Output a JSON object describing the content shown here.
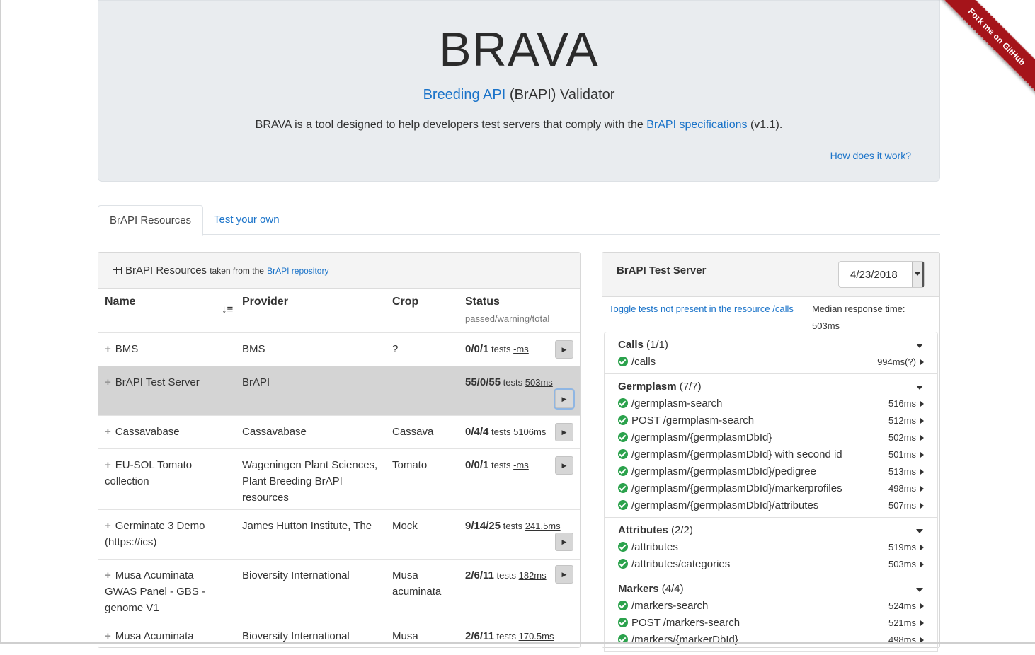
{
  "header": {
    "title": "BRAVA",
    "subtitle_link": "Breeding API",
    "subtitle_rest": " (BrAPI) Validator",
    "desc_pre": "BRAVA is a tool designed to help developers test servers that comply with the ",
    "desc_link": "BrAPI specifications",
    "desc_post": " (v1.1).",
    "how_link": "How does it work?",
    "ribbon": "Fork me on GitHub"
  },
  "tabs": [
    "BrAPI Resources",
    "Test your own"
  ],
  "resources": {
    "heading": "BrAPI Resources",
    "taken_from": "taken from the",
    "repo_link": "BrAPI repository",
    "columns": {
      "name": "Name",
      "provider": "Provider",
      "crop": "Crop",
      "status": "Status",
      "status_sub": "passed/warning/total"
    },
    "tests_word": "tests",
    "rows": [
      {
        "name": "BMS",
        "provider": "BMS",
        "crop": "?",
        "status": "0/0/1",
        "ms": "-ms"
      },
      {
        "name": "BrAPI Test Server",
        "provider": "BrAPI",
        "crop": "",
        "status": "55/0/55",
        "ms": "503ms"
      },
      {
        "name": "Cassavabase",
        "provider": "Cassavabase",
        "crop": "Cassava",
        "status": "0/4/4",
        "ms": "5106ms"
      },
      {
        "name": "EU-SOL Tomato collection",
        "provider": "Wageningen Plant Sciences, Plant Breeding BrAPI resources",
        "crop": "Tomato",
        "status": "0/0/1",
        "ms": "-ms"
      },
      {
        "name": "Germinate 3 Demo (https://ics)",
        "provider": "James Hutton Institute, The",
        "crop": "Mock",
        "status": "9/14/25",
        "ms": "241.5ms"
      },
      {
        "name": "Musa Acuminata GWAS Panel - GBS - genome V1",
        "provider": "Bioversity International",
        "crop": "Musa acuminata",
        "status": "2/6/11",
        "ms": "182ms"
      },
      {
        "name": "Musa Acuminata",
        "provider": "Bioversity International",
        "crop": "Musa",
        "status": "2/6/11",
        "ms": "170.5ms"
      }
    ]
  },
  "server": {
    "title": "BrAPI Test Server",
    "date": "4/23/2018",
    "toggle": "Toggle tests not present in the resource /calls",
    "median_label": "Median response time:",
    "median_value": "503ms",
    "groups": [
      {
        "name": "Calls",
        "count": "(1/1)",
        "calls": [
          {
            "path": "/calls",
            "time": "994ms",
            "note": "(?)"
          }
        ]
      },
      {
        "name": "Germplasm",
        "count": "(7/7)",
        "calls": [
          {
            "path": "/germplasm-search",
            "time": "516ms"
          },
          {
            "path": "POST /germplasm-search",
            "time": "512ms"
          },
          {
            "path": "/germplasm/{germplasmDbId}",
            "time": "502ms"
          },
          {
            "path": "/germplasm/{germplasmDbId} with second id",
            "time": "501ms"
          },
          {
            "path": "/germplasm/{germplasmDbId}/pedigree",
            "time": "513ms"
          },
          {
            "path": "/germplasm/{germplasmDbId}/markerprofiles",
            "time": "498ms"
          },
          {
            "path": "/germplasm/{germplasmDbId}/attributes",
            "time": "507ms"
          }
        ]
      },
      {
        "name": "Attributes",
        "count": "(2/2)",
        "calls": [
          {
            "path": "/attributes",
            "time": "519ms"
          },
          {
            "path": "/attributes/categories",
            "time": "503ms"
          }
        ]
      },
      {
        "name": "Markers",
        "count": "(4/4)",
        "calls": [
          {
            "path": "/markers-search",
            "time": "524ms"
          },
          {
            "path": "POST /markers-search",
            "time": "521ms"
          },
          {
            "path": "/markers/{markerDbId}",
            "time": "498ms"
          }
        ]
      }
    ]
  }
}
